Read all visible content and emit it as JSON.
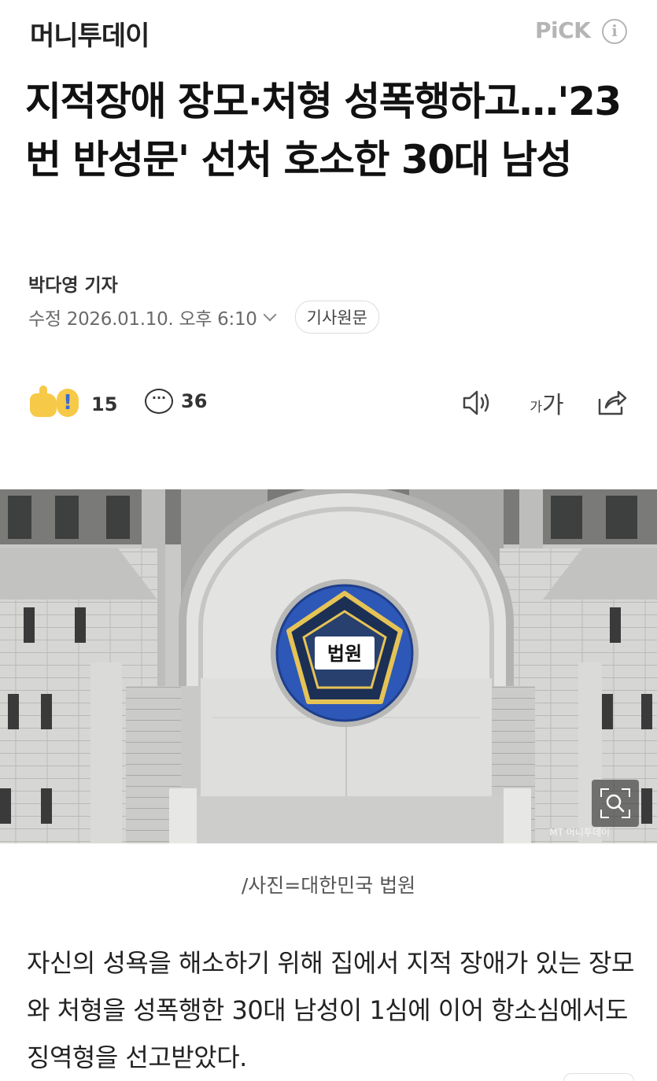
{
  "header": {
    "press_name": "머니투데이",
    "pick_label": "PiCK",
    "info_icon": "i"
  },
  "article": {
    "title": "지적장애 장모·처형 성폭행하고…'23번 반성문' 선처 호소한 30대 남성",
    "reporter": "박다영 기자",
    "updated": "수정 2026.01.10. 오후 6:10",
    "original_button": "기사원문"
  },
  "actions": {
    "reaction_count": "15",
    "comment_count": "36",
    "font_small": "가",
    "font_large": "가",
    "icons": [
      "reaction-icon",
      "comment-icon",
      "speaker-icon",
      "font-size-icon",
      "share-icon"
    ]
  },
  "photo": {
    "emblem_text": "법원",
    "watermark": "MT 머니투데이",
    "caption": "/사진=대한민국 법원"
  },
  "body": {
    "paragraph": "자신의 성욕을 해소하기 위해 집에서 지적 장애가 있는 장모와 처형을 성폭행한 30대 남성이 1심에 이어 항소심에서도 징역형을 선고받았다."
  }
}
